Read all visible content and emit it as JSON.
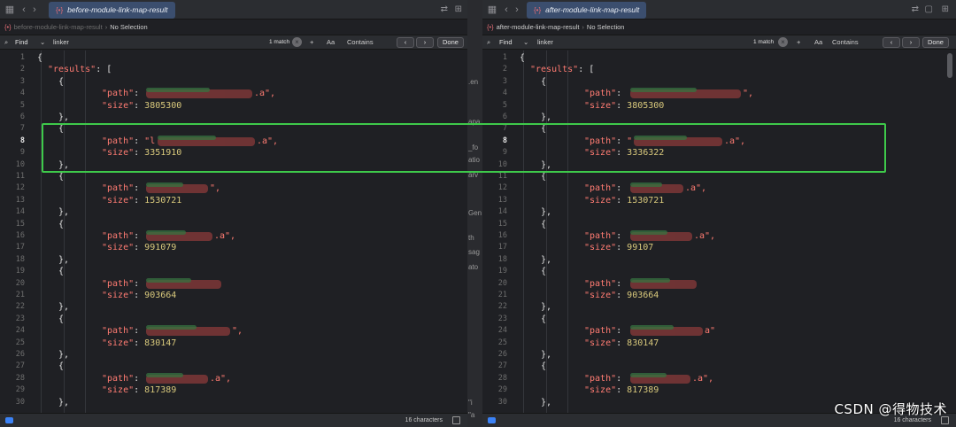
{
  "left": {
    "tab_title": "before-module-link-map-result",
    "breadcrumb_file": "before-module-link-map-result",
    "breadcrumb_selection": "No Selection",
    "find": {
      "mode": "Find",
      "query": "linker",
      "matches": "1 match",
      "plus": "+",
      "case": "Aa",
      "match_mode": "Contains",
      "done": "Done"
    },
    "status": "16 characters",
    "lines": [
      {
        "no": "1",
        "t": "{"
      },
      {
        "no": "2",
        "t": "  \"results\": ["
      },
      {
        "no": "3",
        "t": "    {"
      },
      {
        "no": "4",
        "key": "\"path\"",
        "tail": ".a\","
      },
      {
        "no": "5",
        "key": "\"size\"",
        "num": "3805300"
      },
      {
        "no": "6",
        "t": "    },"
      },
      {
        "no": "7",
        "t": "    {"
      },
      {
        "no": "8",
        "key": "\"path\"",
        "pre": "\"l",
        "tail": ".a\","
      },
      {
        "no": "9",
        "key": "\"size\"",
        "num": "3351910"
      },
      {
        "no": "10",
        "t": "    },"
      },
      {
        "no": "11",
        "t": "    {"
      },
      {
        "no": "12",
        "key": "\"path\"",
        "tail": "\","
      },
      {
        "no": "13",
        "key": "\"size\"",
        "num": "1530721"
      },
      {
        "no": "14",
        "t": "    },"
      },
      {
        "no": "15",
        "t": "    {"
      },
      {
        "no": "16",
        "key": "\"path\"",
        "tail": ".a\","
      },
      {
        "no": "17",
        "key": "\"size\"",
        "num": "991079"
      },
      {
        "no": "18",
        "t": "    },"
      },
      {
        "no": "19",
        "t": "    {"
      },
      {
        "no": "20",
        "key": "\"path\"",
        "tail": ""
      },
      {
        "no": "21",
        "key": "\"size\"",
        "num": "903664"
      },
      {
        "no": "22",
        "t": "    },"
      },
      {
        "no": "23",
        "t": "    {"
      },
      {
        "no": "24",
        "key": "\"path\"",
        "tail": "\","
      },
      {
        "no": "25",
        "key": "\"size\"",
        "num": "830147"
      },
      {
        "no": "26",
        "t": "    },"
      },
      {
        "no": "27",
        "t": "    {"
      },
      {
        "no": "28",
        "key": "\"path\"",
        "tail": ".a\","
      },
      {
        "no": "29",
        "key": "\"size\"",
        "num": "817389"
      },
      {
        "no": "30",
        "t": "    },"
      }
    ]
  },
  "right": {
    "tab_title": "after-module-link-map-result",
    "breadcrumb_file": "after-module-link-map-result",
    "breadcrumb_selection": "No Selection",
    "find": {
      "mode": "Find",
      "query": "linker",
      "matches": "1 match",
      "plus": "+",
      "case": "Aa",
      "match_mode": "Contains",
      "done": "Done"
    },
    "status": "16 characters",
    "lines": [
      {
        "no": "1",
        "t": "{"
      },
      {
        "no": "2",
        "t": "  \"results\": ["
      },
      {
        "no": "3",
        "t": "    {"
      },
      {
        "no": "4",
        "key": "\"path\"",
        "tail": "\","
      },
      {
        "no": "5",
        "key": "\"size\"",
        "num": "3805300"
      },
      {
        "no": "6",
        "t": "    },"
      },
      {
        "no": "7",
        "t": "    {"
      },
      {
        "no": "8",
        "key": "\"path\"",
        "pre": "\"",
        "tail": ".a\","
      },
      {
        "no": "9",
        "key": "\"size\"",
        "num": "3336322"
      },
      {
        "no": "10",
        "t": "    },"
      },
      {
        "no": "11",
        "t": "    {"
      },
      {
        "no": "12",
        "key": "\"path\"",
        "tail": ".a\","
      },
      {
        "no": "13",
        "key": "\"size\"",
        "num": "1530721"
      },
      {
        "no": "14",
        "t": "    },"
      },
      {
        "no": "15",
        "t": "    {"
      },
      {
        "no": "16",
        "key": "\"path\"",
        "tail": ".a\","
      },
      {
        "no": "17",
        "key": "\"size\"",
        "num": "99107"
      },
      {
        "no": "18",
        "t": "    },"
      },
      {
        "no": "19",
        "t": "    {"
      },
      {
        "no": "20",
        "key": "\"path\"",
        "tail": ""
      },
      {
        "no": "21",
        "key": "\"size\"",
        "num": "903664"
      },
      {
        "no": "22",
        "t": "    },"
      },
      {
        "no": "23",
        "t": "    {"
      },
      {
        "no": "24",
        "key": "\"path\"",
        "tail": "a\""
      },
      {
        "no": "25",
        "key": "\"size\"",
        "num": "830147"
      },
      {
        "no": "26",
        "t": "    },"
      },
      {
        "no": "27",
        "t": "    {"
      },
      {
        "no": "28",
        "key": "\"path\"",
        "tail": ".a\","
      },
      {
        "no": "29",
        "key": "\"size\"",
        "num": "817389"
      },
      {
        "no": "30",
        "t": "    },"
      }
    ]
  },
  "gap_fragments": [
    ".en",
    "apa",
    "_fo",
    "atio",
    "arv",
    "Gen",
    "th",
    "sag",
    "ato",
    "\"i",
    "\"a"
  ],
  "watermark": "CSDN @得物技术",
  "colors": {
    "highlight": "#3ec94a",
    "key": "#ff7b72",
    "number": "#d9c97c",
    "tab": "#3b4e6e"
  }
}
